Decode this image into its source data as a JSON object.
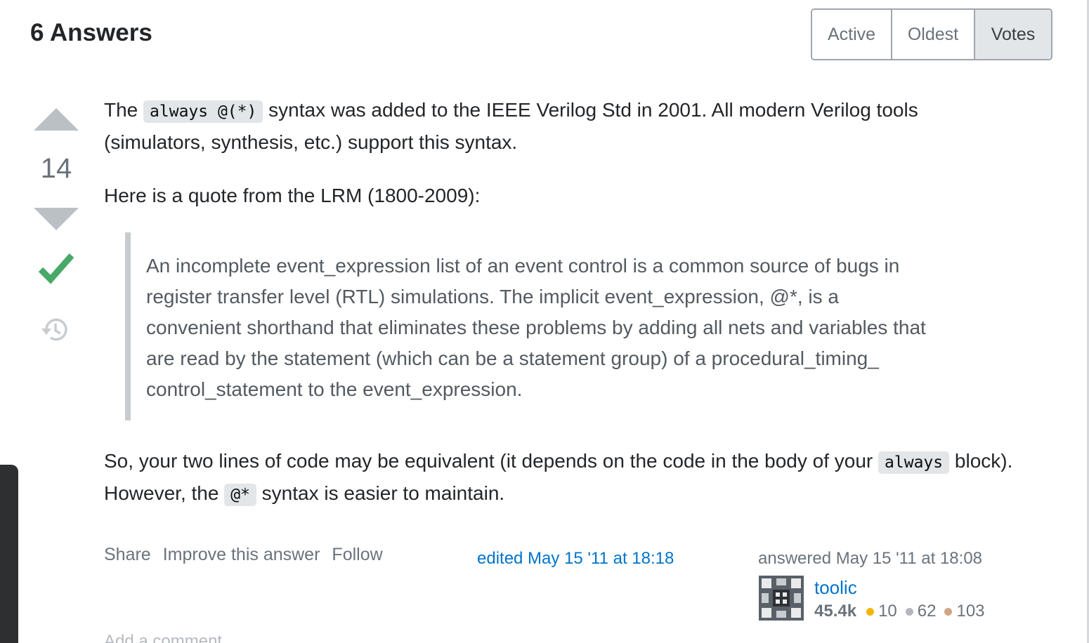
{
  "header": {
    "answers_count": "6 Answers",
    "sort_tabs": [
      {
        "label": "Active",
        "selected": false
      },
      {
        "label": "Oldest",
        "selected": false
      },
      {
        "label": "Votes",
        "selected": true
      }
    ]
  },
  "vote": {
    "count": "14",
    "upvote_icon": "triangle-up-icon",
    "downvote_icon": "triangle-down-icon",
    "accepted_icon": "checkmark-icon",
    "history_icon": "history-icon"
  },
  "answer": {
    "p1_before": "The ",
    "p1_code": "always @(*)",
    "p1_after": " syntax was added to the IEEE Verilog Std in 2001. All modern Verilog tools (simulators, synthesis, etc.) support this syntax.",
    "p2": "Here is a quote from the LRM (1800-2009):",
    "quote_lines": [
      "An incomplete event_expression list of an event control is a common source of bugs in",
      "register transfer level (RTL) simulations. The implicit event_expression, @*, is a",
      "convenient shorthand that eliminates these problems by adding all nets and variables that",
      "are read by the statement (which can be a statement group) of a procedural_timing_",
      "control_statement to the event_expression."
    ],
    "p3_before": "So, your two lines of code may be equivalent (it depends on the code in the body of your ",
    "p3_code1": "always",
    "p3_middle": " block). However, the ",
    "p3_code2": "@*",
    "p3_after": " syntax is easier to maintain."
  },
  "footer": {
    "share": "Share",
    "improve": "Improve this answer",
    "follow": "Follow",
    "edited": "edited May 15 '11 at 18:18",
    "answered": "answered May 15 '11 at 18:08",
    "user": {
      "name": "toolic",
      "reputation": "45.4k",
      "gold": "10",
      "silver": "62",
      "bronze": "103"
    },
    "add_comment": "Add a comment"
  },
  "colors": {
    "link": "#0074cc",
    "accepted": "#48a868",
    "gold": "#f1b600",
    "silver": "#9a9c9f",
    "bronze": "#ab8259"
  }
}
